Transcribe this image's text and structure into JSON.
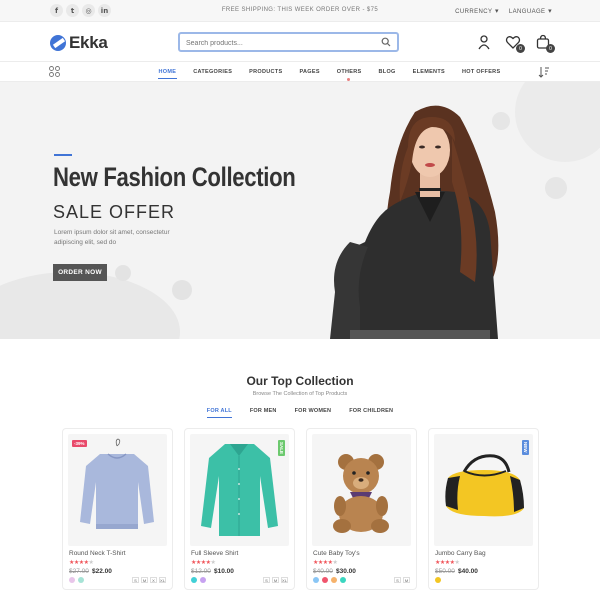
{
  "topbar": {
    "social": [
      {
        "icon": "facebook-icon",
        "glyph": "f"
      },
      {
        "icon": "twitter-icon",
        "glyph": "t"
      },
      {
        "icon": "instagram-icon",
        "glyph": "◎"
      },
      {
        "icon": "linkedin-icon",
        "glyph": "in"
      }
    ],
    "shipping": "FREE SHIPPING: THIS WEEK ORDER OVER - $75",
    "currency": "CURRENCY",
    "language": "LANGUAGE"
  },
  "header": {
    "logo": "Ekka",
    "search_placeholder": "Search products...",
    "wishlist_count": "0",
    "cart_count": "0"
  },
  "nav": {
    "items": [
      "HOME",
      "CATEGORIES",
      "PRODUCTS",
      "PAGES",
      "OTHERS",
      "BLOG",
      "ELEMENTS",
      "HOT OFFERS"
    ]
  },
  "hero": {
    "title": "New Fashion Collection",
    "subtitle": "SALE OFFER",
    "description": "Lorem ipsum dolor sit amet, consectetur adipiscing elit, sed do",
    "button": "ORDER NOW"
  },
  "collection": {
    "title": "Our Top Collection",
    "subtitle": "Browse The Collection of Top Products",
    "tabs": [
      "FOR ALL",
      "FOR MEN",
      "FOR WOMEN",
      "FOR CHILDREN"
    ],
    "products": [
      {
        "name": "Round Neck T-Shirt",
        "old_price": "$27.00",
        "price": "$22.00",
        "rating": 4,
        "tag": "-39%",
        "tag_color": "#e94a6b",
        "swatches": [
          "#e8c6ea",
          "#a7e3d6"
        ],
        "sizes": [
          "S",
          "M",
          "X",
          "XL"
        ]
      },
      {
        "name": "Full Sleeve Shirt",
        "old_price": "$12.00",
        "price": "$10.00",
        "rating": 4,
        "tag": "SALE",
        "tag_color": "#6cc96e",
        "swatches": [
          "#41d0d6",
          "#c7a2f0"
        ],
        "sizes": [
          "S",
          "M",
          "XL"
        ]
      },
      {
        "name": "Cute Baby Toy's",
        "old_price": "$40.00",
        "price": "$30.00",
        "rating": 4,
        "tag": "",
        "tag_color": "",
        "swatches": [
          "#8ac6f5",
          "#f0556d",
          "#f6b26b",
          "#3ad6c0"
        ],
        "sizes": [
          "S",
          "M"
        ]
      },
      {
        "name": "Jumbo Carry Bag",
        "old_price": "$50.00",
        "price": "$40.00",
        "rating": 4,
        "tag": "NEW",
        "tag_color": "#5b8ddd",
        "swatches": [
          "#f3c623"
        ],
        "sizes": []
      }
    ]
  },
  "colors": {
    "accent": "#4074d6",
    "star": "#f0555a"
  }
}
